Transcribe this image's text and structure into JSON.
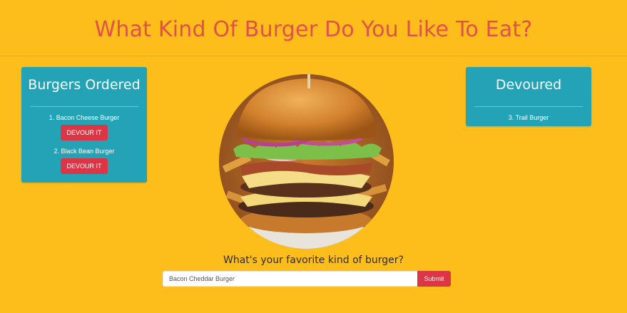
{
  "header": {
    "title": "What Kind Of Burger Do You Like To Eat?"
  },
  "ordered": {
    "title": "Burgers Ordered",
    "items": [
      {
        "label": "1. Bacon Cheese Burger",
        "button": "DEVOUR IT"
      },
      {
        "label": "2. Black Bean Burger",
        "button": "DEVOUR IT"
      }
    ]
  },
  "devoured": {
    "title": "Devoured",
    "items": [
      {
        "label": "3. Trail Burger"
      }
    ]
  },
  "form": {
    "question": "What's your favorite kind of burger?",
    "input_value": "Bacon Cheddar Burger",
    "submit_label": "Submit"
  },
  "colors": {
    "background": "#fdbe1b",
    "title": "#e2504a",
    "card": "#24a3b6",
    "button": "#dc3545"
  }
}
